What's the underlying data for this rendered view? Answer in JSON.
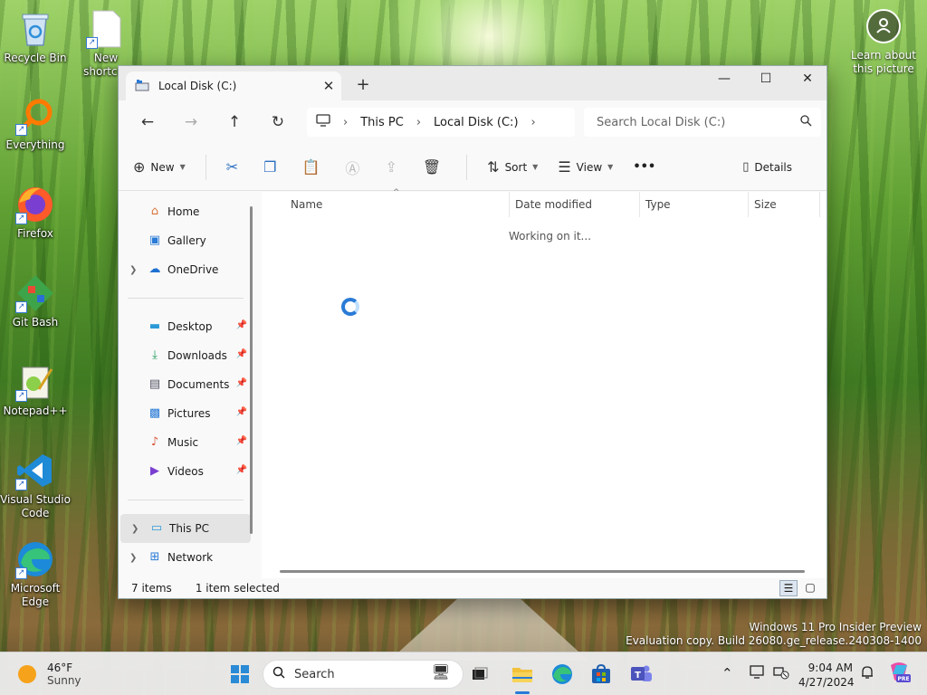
{
  "desktop": {
    "icons": [
      {
        "label": "Recycle Bin"
      },
      {
        "label": "New shortcut"
      },
      {
        "label": "Everything"
      },
      {
        "label": "Firefox"
      },
      {
        "label": "Git Bash"
      },
      {
        "label": "Notepad++"
      },
      {
        "label": "Visual Studio Code"
      },
      {
        "label": "Microsoft Edge"
      }
    ],
    "learn_about": "Learn about this picture",
    "watermark_line1": "Windows 11 Pro Insider Preview",
    "watermark_line2": "Evaluation copy. Build 26080.ge_release.240308-1400"
  },
  "explorer": {
    "tab_title": "Local Disk (C:)",
    "controls": {
      "minimize": "—",
      "maximize": "☐",
      "close": "✕"
    },
    "address": {
      "segments": [
        "This PC",
        "Local Disk (C:)"
      ]
    },
    "search_placeholder": "Search Local Disk (C:)",
    "toolbar": {
      "new_label": "New",
      "sort_label": "Sort",
      "view_label": "View",
      "more_label": "•••",
      "details_label": "Details"
    },
    "nav": {
      "home": "Home",
      "gallery": "Gallery",
      "onedrive": "OneDrive",
      "desktop": "Desktop",
      "downloads": "Downloads",
      "documents": "Documents",
      "pictures": "Pictures",
      "music": "Music",
      "videos": "Videos",
      "this_pc": "This PC",
      "network": "Network"
    },
    "columns": {
      "name": "Name",
      "date": "Date modified",
      "type": "Type",
      "size": "Size"
    },
    "working_text": "Working on it...",
    "status": {
      "items": "7 items",
      "selected": "1 item selected"
    }
  },
  "taskbar": {
    "weather_temp": "46°F",
    "weather_cond": "Sunny",
    "search_label": "Search",
    "time": "9:04 AM",
    "date": "4/27/2024"
  },
  "colors": {
    "accent": "#2a7bd6",
    "window_bg": "#f9f9f9",
    "selection": "#e4e4e4"
  }
}
